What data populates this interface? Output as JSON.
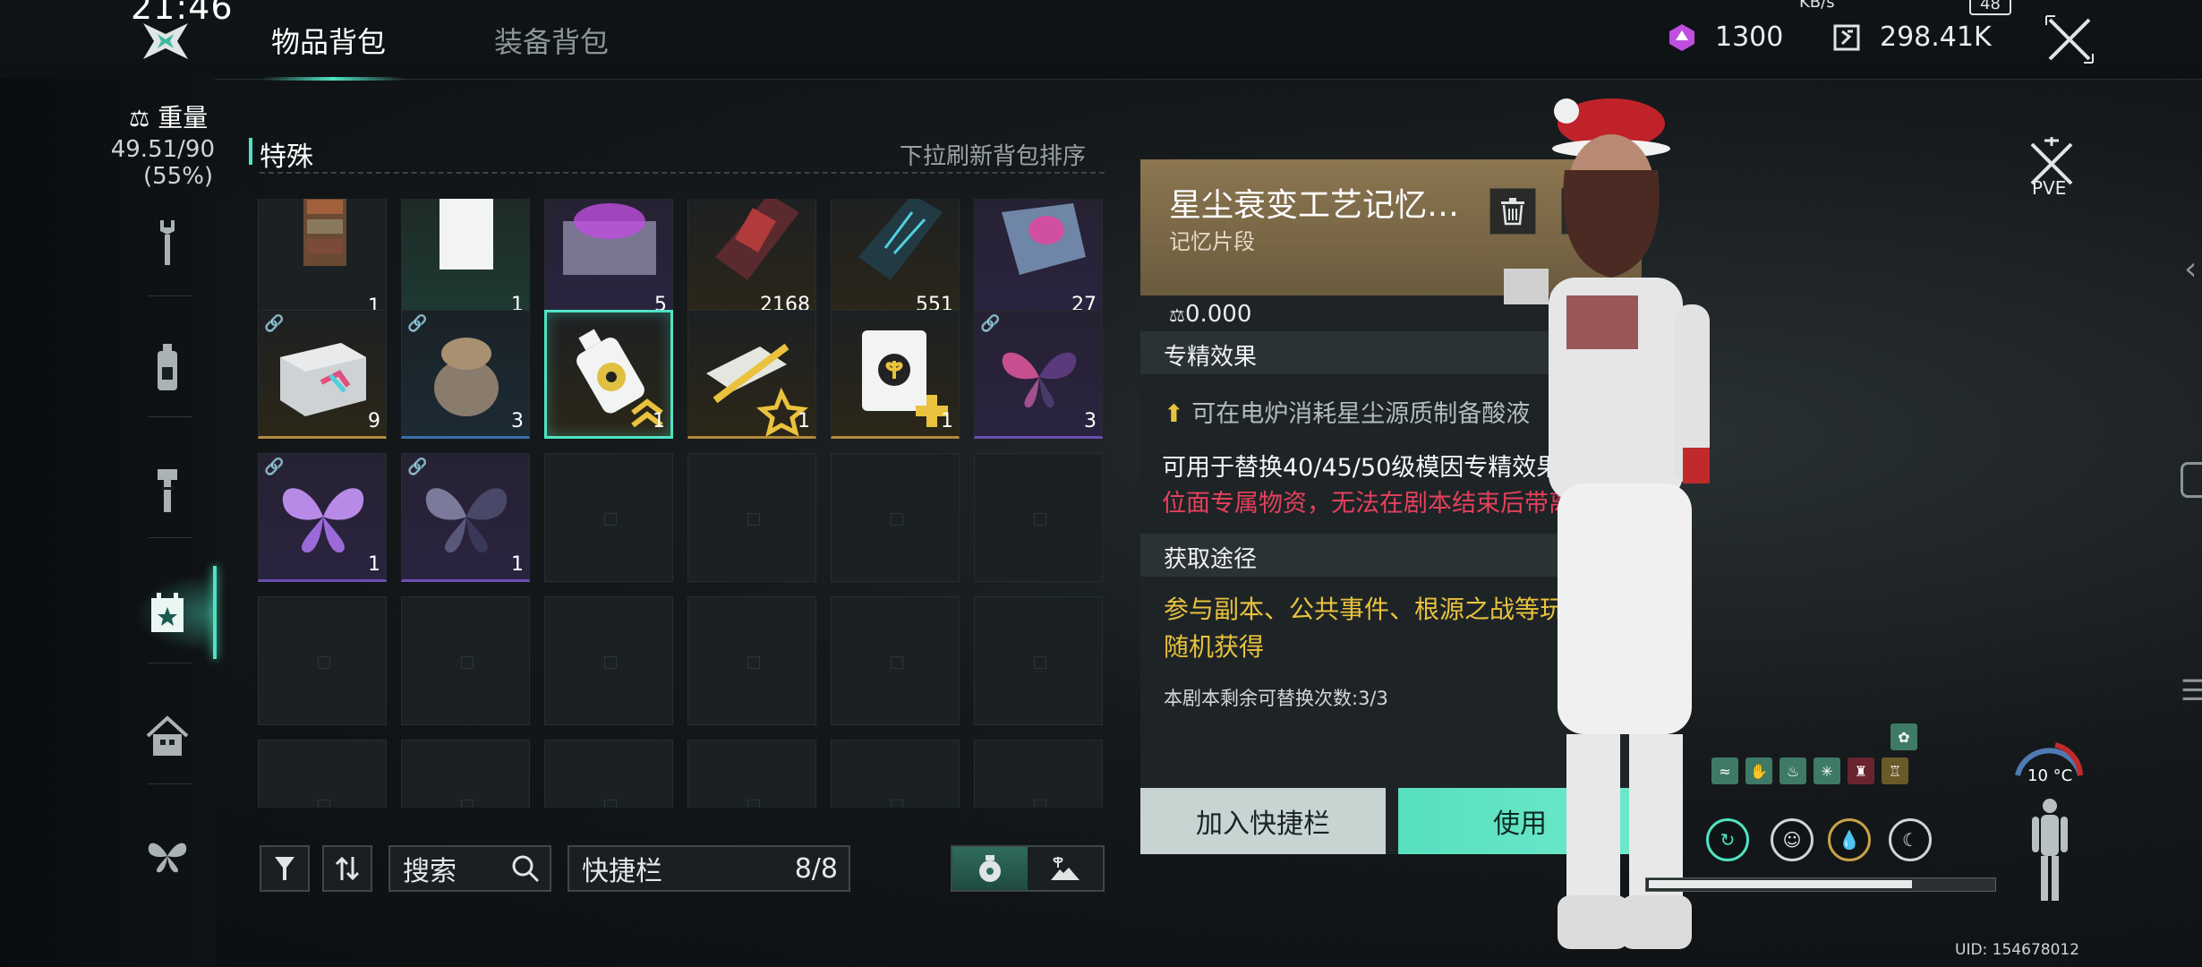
{
  "status": {
    "time": "21:46",
    "net_unit": "KB/s",
    "battery": "48"
  },
  "tabs": {
    "active": "物品背包",
    "inactive": "装备背包"
  },
  "currency": [
    {
      "icon": "crystal-icon",
      "value": "1300"
    },
    {
      "icon": "coin-icon",
      "value": "298.41K"
    }
  ],
  "weight": {
    "label": "重量",
    "value": "49.51/90",
    "percent": "(55%)"
  },
  "nav": [
    "wrench-icon",
    "bottle-icon",
    "hammer-icon",
    "calendar-star-icon",
    "home-icon",
    "butterfly-icon"
  ],
  "section": {
    "title": "特殊",
    "hint": "下拉刷新背包排序"
  },
  "inventory": {
    "rows": [
      [
        {
          "icon": "bookshelf-item",
          "count": "1",
          "rarity": "plain"
        },
        {
          "icon": "white-card-item",
          "count": "1",
          "rarity": "green"
        },
        {
          "icon": "purple-chest-item",
          "count": "5",
          "rarity": "purple"
        },
        {
          "icon": "red-book-item",
          "count": "2168",
          "rarity": "gold"
        },
        {
          "icon": "blue-book-item",
          "count": "551",
          "rarity": "gold"
        },
        {
          "icon": "crystal-cube-item",
          "count": "27",
          "rarity": "purple"
        }
      ],
      [
        {
          "icon": "box-item",
          "count": "9",
          "rarity": "gold",
          "linked": true
        },
        {
          "icon": "sack-item",
          "count": "3",
          "rarity": "blue",
          "linked": true
        },
        {
          "icon": "potion-bottle-item",
          "count": "1",
          "rarity": "gold",
          "selected": true
        },
        {
          "icon": "weapon-blueprint-item",
          "count": "1",
          "rarity": "gold"
        },
        {
          "icon": "seed-pack-item",
          "count": "1",
          "rarity": "gold"
        },
        {
          "icon": "pink-butterfly-item",
          "count": "3",
          "rarity": "purple",
          "linked": true
        }
      ],
      [
        {
          "icon": "violet-butterfly-item",
          "count": "1",
          "rarity": "purple",
          "linked": true
        },
        {
          "icon": "dark-butterfly-item",
          "count": "1",
          "rarity": "purple",
          "linked": true
        }
      ]
    ]
  },
  "controls": {
    "filter_icon": "filter-icon",
    "sort_icon": "sort-icon",
    "search_label": "搜索",
    "quickbar_label": "快捷栏",
    "quickbar_value": "8/8"
  },
  "detail": {
    "title": "星尘衰变工艺记忆…",
    "subtitle": "记忆片段",
    "weight": "0.000",
    "section_effect": "专精效果",
    "effect": "可在电炉消耗星尘源质制备酸液",
    "desc": "可用于替换40/45/50级模因专精效果。",
    "warning": "位面专属物资，无法在剧本结束后带离。",
    "section_source": "获取途径",
    "source": "参与副本、公共事件、根源之战等玩法随机获得",
    "remaining": "本剧本剩余可替换次数:3/3",
    "btn_quick": "加入快捷栏",
    "btn_use": "使用"
  },
  "character": {
    "mode": "PVE",
    "temperature": "10 °C",
    "stamina_fraction": 0.77,
    "uid": "UID: 154678012"
  },
  "colors": {
    "accent": "#4fe3c3",
    "warning": "#e4405c",
    "source": "#e9c23e",
    "header": "#8b7650"
  }
}
